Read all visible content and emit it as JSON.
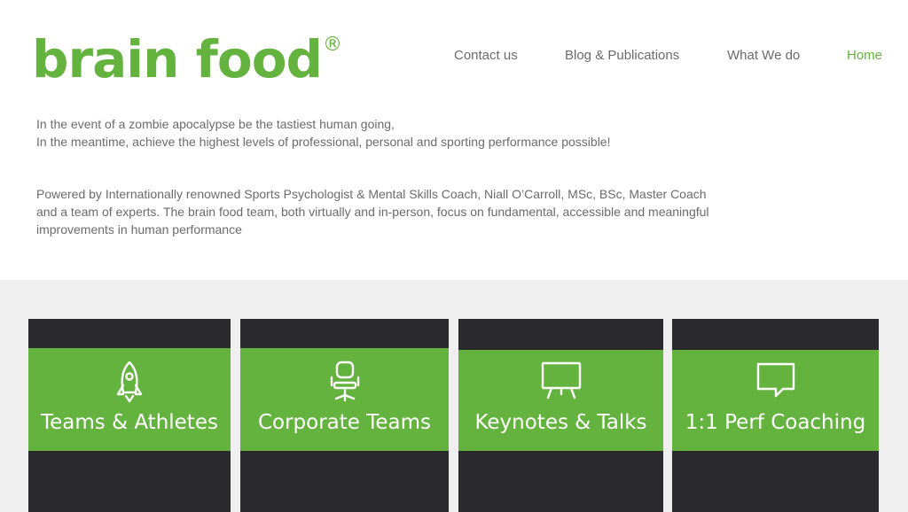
{
  "brand": {
    "name": "brain food",
    "registered_mark": "®",
    "color": "#63b33e"
  },
  "nav": [
    {
      "label": "Contact us",
      "active": false
    },
    {
      "label": "Blog & Publications",
      "active": false
    },
    {
      "label": "What We do",
      "active": false
    },
    {
      "label": "Home",
      "active": true
    }
  ],
  "intro": {
    "line1": "In the event of a zombie apocalypse be the tastiest human going,",
    "line2": "In the meantime, achieve the highest levels of professional, personal and sporting performance possible!",
    "para2_line1": "Powered by Internationally renowned Sports Psychologist & Mental Skills Coach, Niall O’Carroll, MSc, BSc, Master Coach",
    "para2_line2": "and a team of experts.  The brain food team, both virtually and in-person, focus on fundamental, accessible and meaningful",
    "para2_line3": "improvements in human performance"
  },
  "services": [
    {
      "label": "Teams & Athletes",
      "icon": "rocket-icon"
    },
    {
      "label": "Corporate Teams",
      "icon": "office-chair-icon"
    },
    {
      "label": "Keynotes & Talks",
      "icon": "presentation-board-icon"
    },
    {
      "label": "1:1 Perf Coaching",
      "icon": "speech-bubble-icon"
    }
  ],
  "colors": {
    "accent": "#63b33e",
    "card_dark": "#2b2b2e",
    "section_bg": "#efefef",
    "text": "#6b6b6b"
  }
}
